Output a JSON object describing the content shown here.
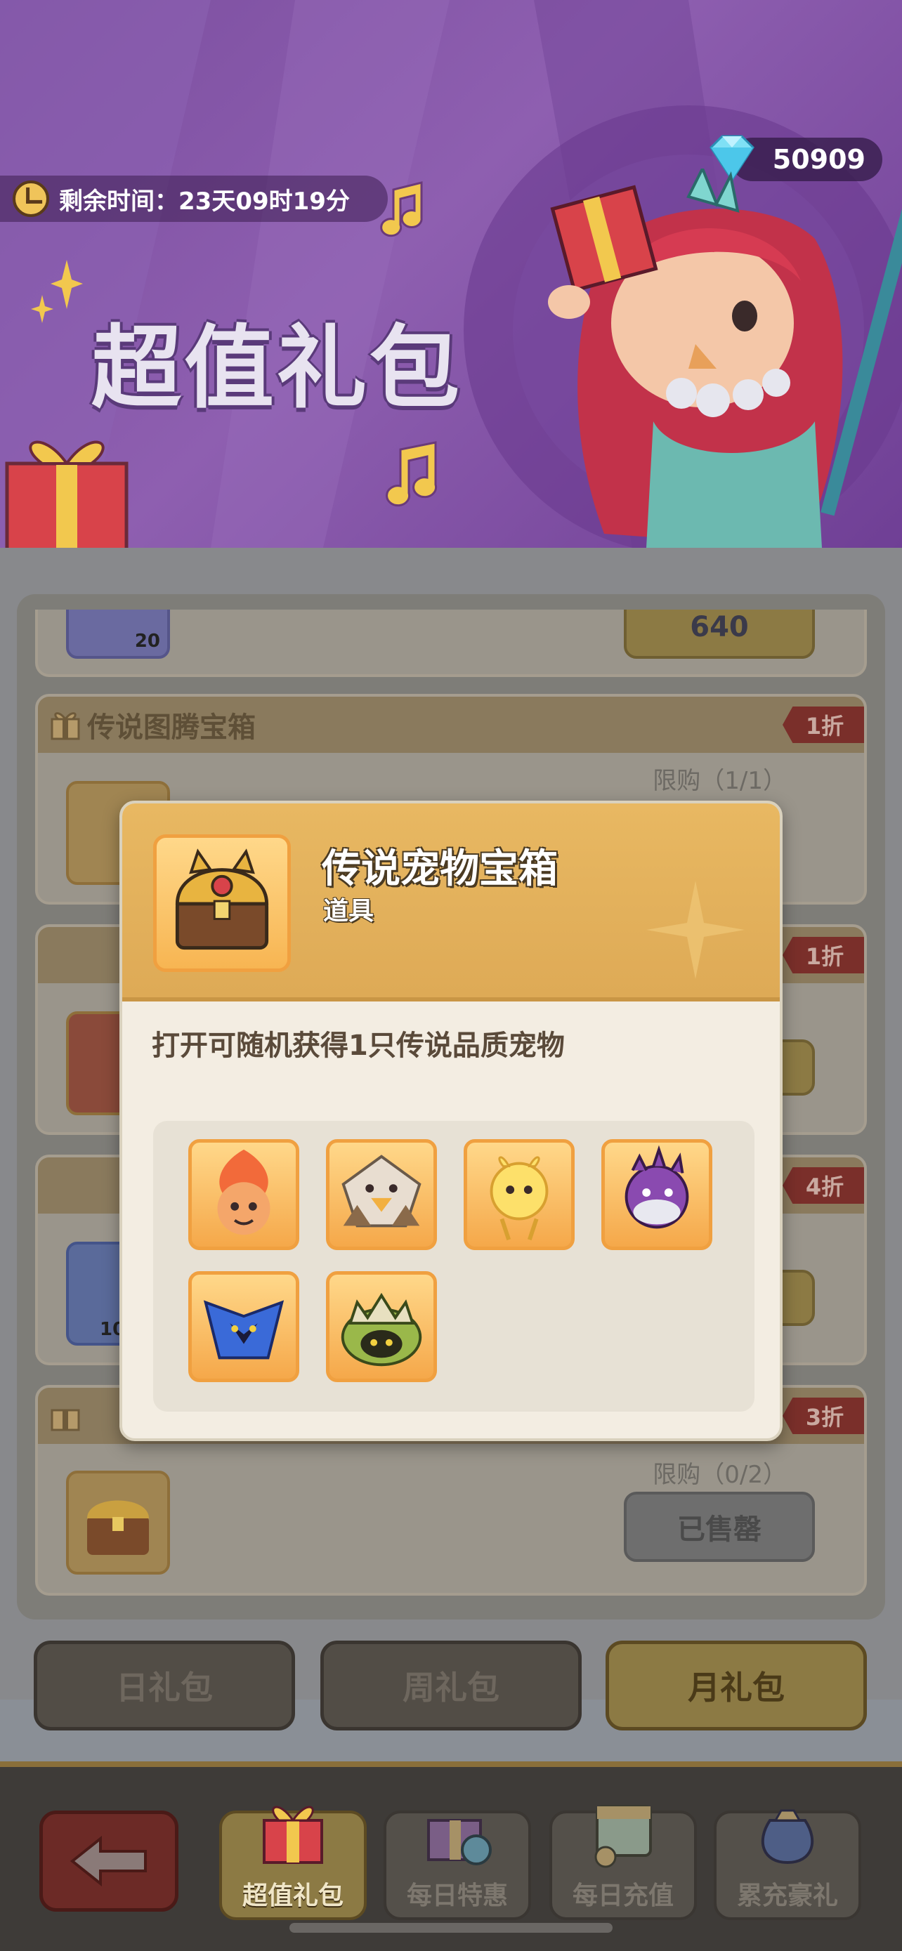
{
  "banner": {
    "timer_label": "剩余时间：23天09时19分",
    "gem_count": "50909",
    "title": "超值礼包"
  },
  "cards": [
    {
      "badge": "20",
      "price_partial": "640"
    },
    {
      "name": "传说图腾宝箱",
      "discount": "1折",
      "limit": "限购（1/1）"
    },
    {
      "discount": "1折"
    },
    {
      "discount": "4折",
      "badge": "10"
    },
    {
      "discount": "3折",
      "limit": "限购（0/2）",
      "button": "已售罄"
    }
  ],
  "tabs": [
    {
      "label": "日礼包",
      "active": false
    },
    {
      "label": "周礼包",
      "active": false
    },
    {
      "label": "月礼包",
      "active": true
    }
  ],
  "nav": [
    {
      "label": "超值礼包",
      "icon": "gift-box-icon",
      "active": true
    },
    {
      "label": "每日特惠",
      "icon": "gift-clock-icon",
      "active": false
    },
    {
      "label": "每日充值",
      "icon": "calendar-coins-icon",
      "active": false
    },
    {
      "label": "累充豪礼",
      "icon": "treasure-bag-icon",
      "active": false
    }
  ],
  "dialog": {
    "title": "传说宠物宝箱",
    "subtitle": "道具",
    "description": "打开可随机获得1只传说品质宠物",
    "pets": [
      "fire-monkey-icon",
      "eagle-icon",
      "yellow-sprite-icon",
      "purple-pufferfish-icon",
      "blue-bird-icon",
      "spiked-turtle-icon"
    ]
  },
  "colors": {
    "accent_gold": "#e8b862",
    "discount_red": "#7a2f2a",
    "banner_purple": "#7b4e9f"
  }
}
